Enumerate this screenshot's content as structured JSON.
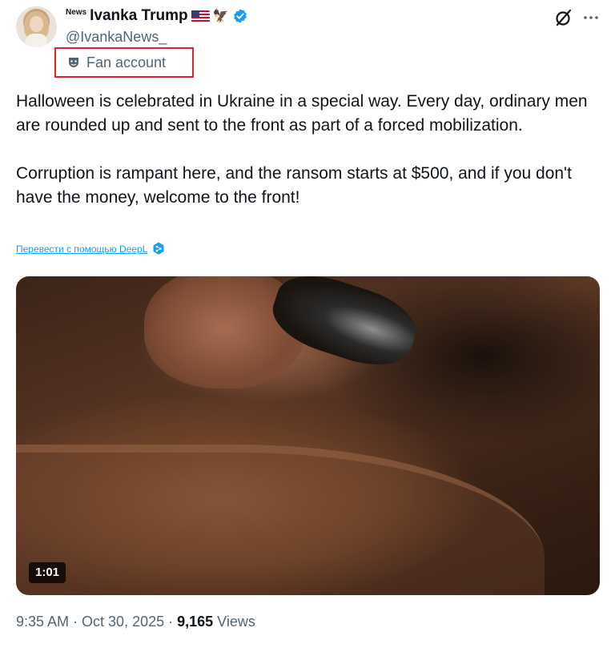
{
  "author": {
    "badge": "News",
    "display_name": "Ivanka Trump",
    "handle": "@IvankaNews_",
    "flag_icon": "us-flag-icon",
    "eagle_icon": "eagle-icon",
    "verified_color": "#1d9bf0"
  },
  "label": {
    "text": "Fan account",
    "highlight_color": "#e0242b"
  },
  "tweet": {
    "paragraphs": [
      "Halloween is celebrated in Ukraine in a special way. Every day, ordinary men are rounded up and sent to the front as part of a forced mobilization.",
      "Corruption is rampant here, and the ransom starts at $500, and if you don't have the money, welcome to the front!"
    ],
    "translate_link": "Перевести с помощью DeepL"
  },
  "media": {
    "duration": "1:01"
  },
  "meta": {
    "time": "9:35 AM",
    "separator": "·",
    "date": "Oct 30, 2025",
    "views_count": "9,165",
    "views_label": "Views"
  }
}
